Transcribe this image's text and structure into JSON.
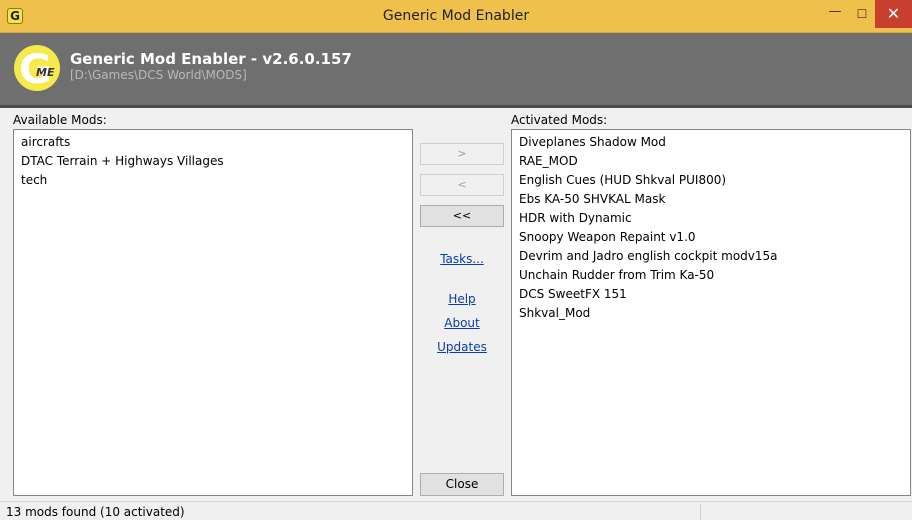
{
  "window": {
    "title": "Generic Mod Enabler",
    "icon_letter": "G",
    "minimize": "—",
    "maximize": "☐",
    "close": "✕"
  },
  "header": {
    "title": "Generic Mod Enabler - v2.6.0.157",
    "path": "[D:\\Games\\DCS World\\MODS]",
    "logo_letter": "G",
    "logo_sub": "ME"
  },
  "available": {
    "label": "Available Mods:",
    "items": [
      "aircrafts",
      "DTAC Terrain + Highways Villages",
      "tech"
    ]
  },
  "activated": {
    "label": "Activated Mods:",
    "items": [
      "Diveplanes Shadow Mod",
      "RAE_MOD",
      "English Cues (HUD Shkval PUI800)",
      "Ebs KA-50 SHVKAL Mask",
      "HDR with Dynamic",
      "Snoopy Weapon Repaint v1.0",
      "Devrim and Jadro english cockpit modv15a",
      "Unchain Rudder from Trim Ka-50",
      "DCS SweetFX 151",
      "Shkval_Mod"
    ]
  },
  "buttons": {
    "activate": ">",
    "deactivate": "<",
    "deactivate_all": "<<",
    "close": "Close"
  },
  "links": {
    "tasks": "Tasks...",
    "help": "Help",
    "about": "About",
    "updates": "Updates"
  },
  "status": {
    "text": "13 mods found (10 activated)"
  },
  "colors": {
    "titlebar": "#f0c04c",
    "header": "#6f6f6f",
    "close_button": "#c7402f",
    "link": "#0a3da8",
    "logo": "#f5ea4a"
  }
}
